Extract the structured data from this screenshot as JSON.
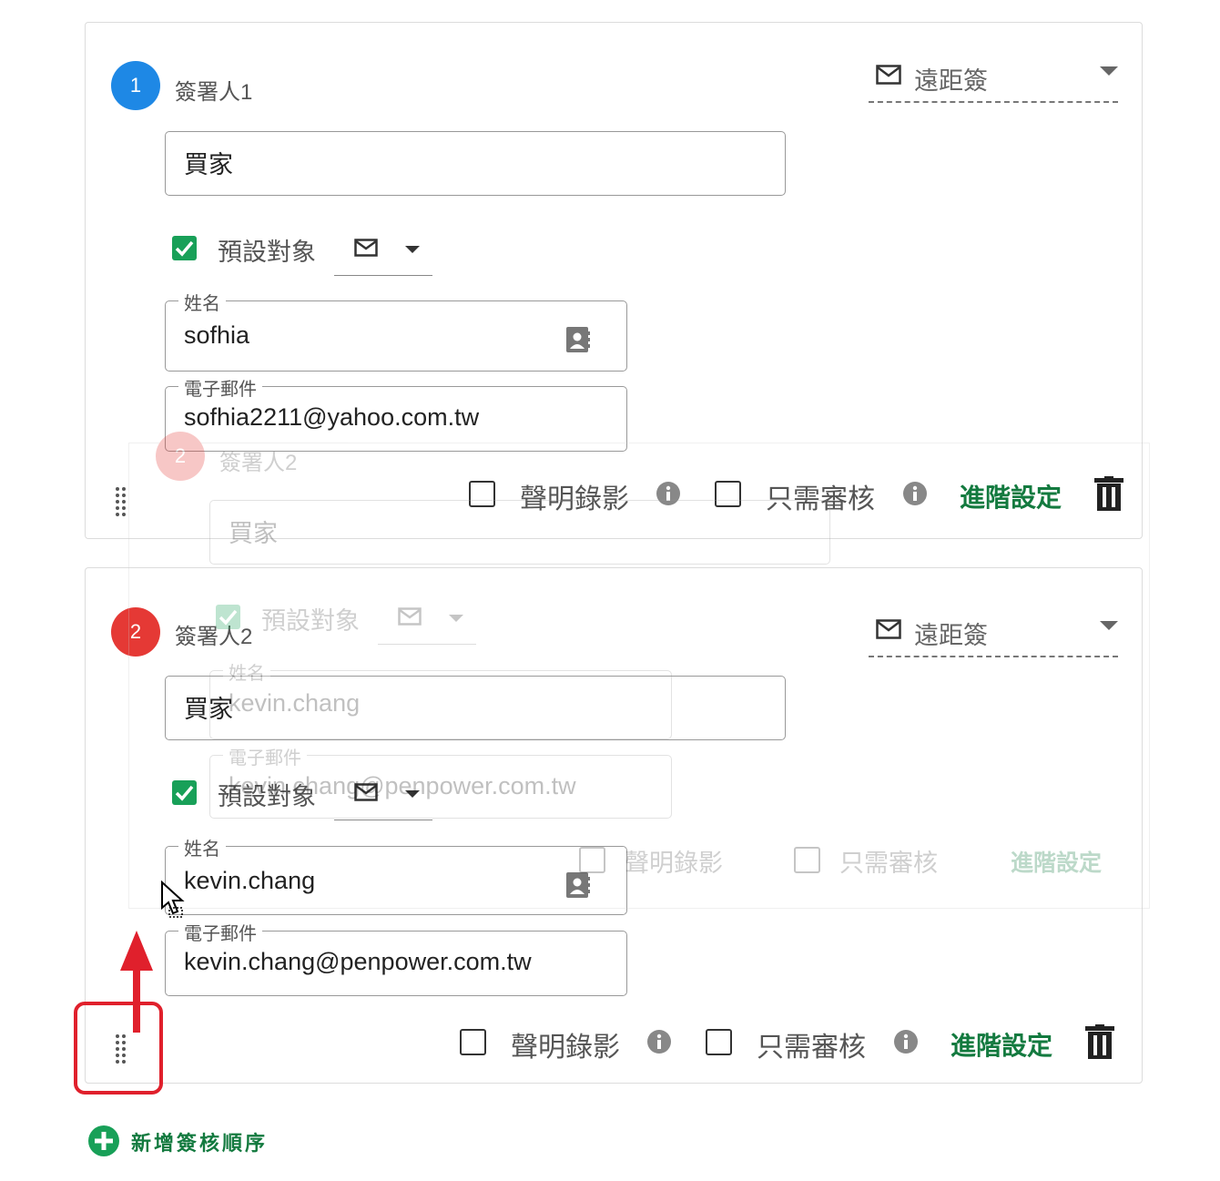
{
  "signers": [
    {
      "number": "1",
      "label": "簽署人1",
      "color": "#1e88e5",
      "sign_mode": "遠距簽",
      "role": "買家",
      "default_target_label": "預設對象",
      "default_target_checked": true,
      "name_label": "姓名",
      "name_value": "sofhia",
      "email_label": "電子郵件",
      "email_value": "sofhia2211@yahoo.com.tw",
      "video_label": "聲明錄影",
      "review_only_label": "只需審核",
      "advanced_label": "進階設定"
    },
    {
      "number": "2",
      "label": "簽署人2",
      "color": "#e53935",
      "sign_mode": "遠距簽",
      "role": "買家",
      "default_target_label": "預設對象",
      "default_target_checked": true,
      "name_label": "姓名",
      "name_value": "kevin.chang",
      "email_label": "電子郵件",
      "email_value": "kevin.chang@penpower.com.tw",
      "video_label": "聲明錄影",
      "review_only_label": "只需審核",
      "advanced_label": "進階設定"
    }
  ],
  "drag_preview": {
    "number": "2",
    "label": "簽署人2",
    "role": "買家",
    "default_target_label": "預設對象",
    "name_label": "姓名",
    "name_value": "kevin.chang",
    "email_label": "電子郵件",
    "email_value": "kevin.chang@penpower.com.tw",
    "video_label": "聲明錄影",
    "review_only_label": "只需審核",
    "advanced_label": "進階設定"
  },
  "add_order_label": "新增簽核順序",
  "colors": {
    "accent_green": "#137a3f",
    "check_green": "#18a058",
    "highlight_red": "#e0202c"
  },
  "icons": [
    "mail-icon",
    "caret-down-icon",
    "contact-card-icon",
    "info-icon",
    "trash-icon",
    "drag-handle-icon",
    "plus-circle-icon",
    "arrow-up-icon",
    "cursor-icon"
  ]
}
